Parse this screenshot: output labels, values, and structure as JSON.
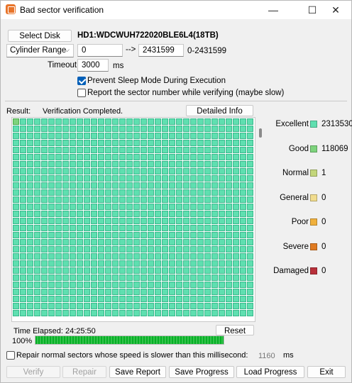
{
  "window": {
    "title": "Bad sector verification",
    "minimize": "—",
    "maximize": "☐",
    "close": "✕"
  },
  "top": {
    "select_disk": "Select Disk",
    "disk_name": "HD1:WDCWUH722020BLE6L4(18TB)",
    "range_mode": "Cylinder Range",
    "range_start": "0",
    "range_arrow": "-->",
    "range_end": "2431599",
    "range_hint": "0-2431599",
    "timeout_label": "Timeout:",
    "timeout_value": "3000",
    "timeout_unit": "ms",
    "prevent_sleep": {
      "label": "Prevent Sleep Mode During Execution",
      "checked": true
    },
    "report_sector": {
      "label": "Report the sector number while verifying (maybe slow)",
      "checked": false
    }
  },
  "result": {
    "label": "Result:",
    "status": "Verification Completed.",
    "detailed_info": "Detailed Info"
  },
  "grid": {
    "columns": 34,
    "rows": 28,
    "good_cells": [
      0
    ]
  },
  "legend": [
    {
      "label": "Excellent",
      "color": "#5fdfb0",
      "value": "2313530"
    },
    {
      "label": "Good",
      "color": "#7dd37c",
      "value": "118069"
    },
    {
      "label": "Normal",
      "color": "#c3d67a",
      "value": "1"
    },
    {
      "label": "General",
      "color": "#f1dc8e",
      "value": "0"
    },
    {
      "label": "Poor",
      "color": "#f0b03c",
      "value": "0"
    },
    {
      "label": "Severe",
      "color": "#e07b22",
      "value": "0"
    },
    {
      "label": "Damaged",
      "color": "#b8303a",
      "value": "0"
    }
  ],
  "status": {
    "time_elapsed": "Time Elapsed: 24:25:50",
    "reset": "Reset",
    "progress_text": "100%",
    "progress": 1.0
  },
  "repair_option": {
    "label": "Repair normal sectors whose speed is slower than this millisecond:",
    "checked": false,
    "value": "1160",
    "unit": "ms"
  },
  "buttons": {
    "verify": "Verify",
    "repair": "Repair",
    "save_report": "Save Report",
    "save_progress": "Save Progress",
    "load_progress": "Load Progress",
    "exit": "Exit"
  }
}
